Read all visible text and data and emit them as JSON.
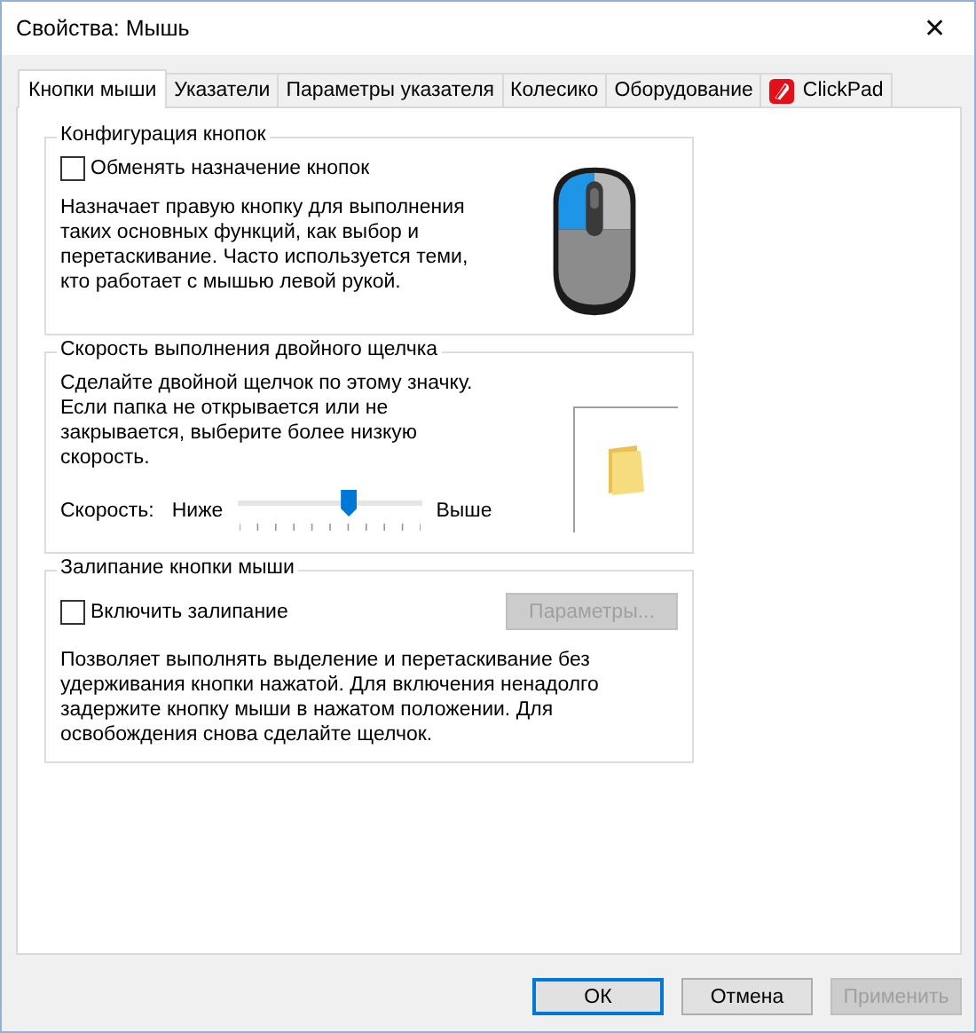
{
  "window": {
    "title": "Свойства: Мышь",
    "close": "✕"
  },
  "tabs": [
    {
      "label": "Кнопки мыши",
      "selected": true,
      "kind": "text"
    },
    {
      "label": "Указатели",
      "selected": false,
      "kind": "text"
    },
    {
      "label": "Параметры указателя",
      "selected": false,
      "kind": "text"
    },
    {
      "label": "Колесико",
      "selected": false,
      "kind": "text"
    },
    {
      "label": "Оборудование",
      "selected": false,
      "kind": "text"
    },
    {
      "label": "ClickPad",
      "selected": false,
      "kind": "icon"
    }
  ],
  "button_config": {
    "title": "Конфигурация кнопок",
    "checkbox": {
      "label": "Обменять назначение кнопок",
      "checked": false
    },
    "description": "Назначает правую кнопку для выполнения таких основных функций, как выбор и перетаскивание. Часто используется теми, кто работает с мышью левой рукой."
  },
  "double_click": {
    "title": "Скорость выполнения двойного щелчка",
    "description": "Сделайте двойной щелчок по этому значку. Если папка не открывается или не закрывается, выберите более низкую скорость.",
    "speed_label": "Скорость:",
    "min_label": "Ниже",
    "max_label": "Выше",
    "level": 0.6
  },
  "click_lock": {
    "title": "Залипание кнопки мыши",
    "checkbox": {
      "label": "Включить залипание",
      "checked": false
    },
    "settings_button": {
      "label": "Параметры...",
      "disabled": true
    },
    "description": "Позволяет выполнять выделение и перетаскивание без удерживания кнопки нажатой. Для включения ненадолго задержите кнопку мыши в нажатом положении. Для освобождения снова сделайте щелчок."
  },
  "buttons": [
    {
      "label": "ОК",
      "default": true,
      "disabled": false
    },
    {
      "label": "Отмена",
      "default": false,
      "disabled": false
    },
    {
      "label": "Применить",
      "default": false,
      "disabled": true
    }
  ]
}
